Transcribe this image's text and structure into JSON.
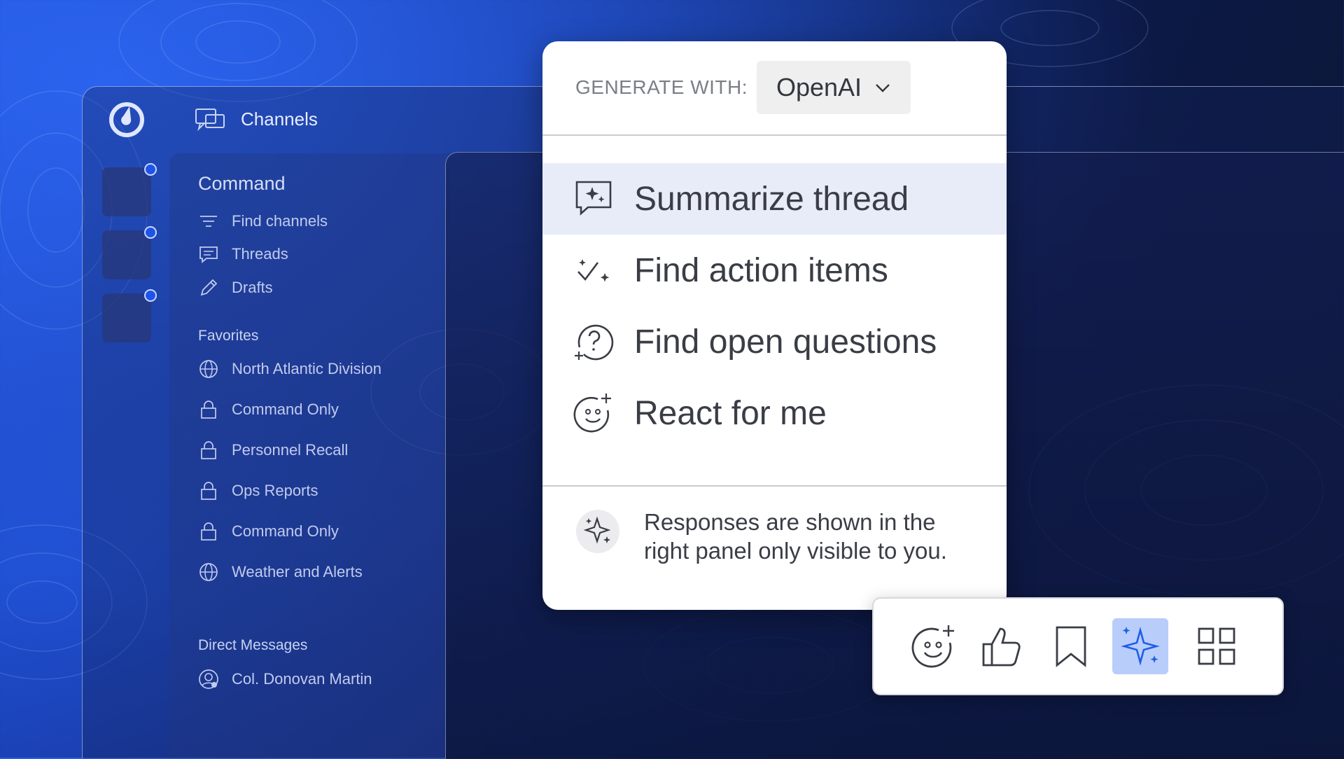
{
  "topbar": {
    "title": "Channels",
    "logo_icon": "mattermost-logo-icon",
    "title_icon": "channels-icon"
  },
  "teams": [
    {
      "unread": true
    },
    {
      "unread": true
    },
    {
      "unread": true
    }
  ],
  "sidebar": {
    "team_name": "Command",
    "nav": [
      {
        "label": "Find channels",
        "icon": "filter-icon"
      },
      {
        "label": "Threads",
        "icon": "threads-icon"
      },
      {
        "label": "Drafts",
        "icon": "pencil-icon"
      }
    ],
    "favorites_label": "Favorites",
    "favorites": [
      {
        "label": "North Atlantic Division",
        "icon": "globe-icon"
      },
      {
        "label": "Command Only",
        "icon": "lock-icon"
      },
      {
        "label": "Personnel Recall",
        "icon": "lock-icon"
      },
      {
        "label": "Ops Reports",
        "icon": "lock-icon"
      },
      {
        "label": "Command Only",
        "icon": "lock-icon"
      },
      {
        "label": "Weather and Alerts",
        "icon": "globe-icon"
      }
    ],
    "dm_label": "Direct Messages",
    "dms": [
      {
        "label": "Col. Donovan Martin",
        "icon": "user-icon"
      }
    ]
  },
  "ai_menu": {
    "generate_label": "GENERATE WITH:",
    "provider": "OpenAI",
    "items": [
      {
        "label": "Summarize thread",
        "icon": "sparkle-chat-icon",
        "highlighted": true
      },
      {
        "label": "Find action items",
        "icon": "check-sparkle-icon",
        "highlighted": false
      },
      {
        "label": "Find open questions",
        "icon": "question-icon",
        "highlighted": false
      },
      {
        "label": "React for me",
        "icon": "emoji-add-icon",
        "highlighted": false
      }
    ],
    "footer_text": "Responses are shown in the right panel only visible to you."
  },
  "toolbar": {
    "buttons": [
      {
        "icon": "emoji-add-icon",
        "active": false
      },
      {
        "icon": "thumbs-up-icon",
        "active": false
      },
      {
        "icon": "bookmark-icon",
        "active": false
      },
      {
        "icon": "ai-sparkle-icon",
        "active": true
      },
      {
        "icon": "apps-grid-icon",
        "active": false
      }
    ]
  },
  "colors": {
    "accent": "#1e55e8",
    "highlight": "#e8ecf8",
    "active_button": "#b9cdfa",
    "sparkle_blue": "#1f5ee8"
  }
}
